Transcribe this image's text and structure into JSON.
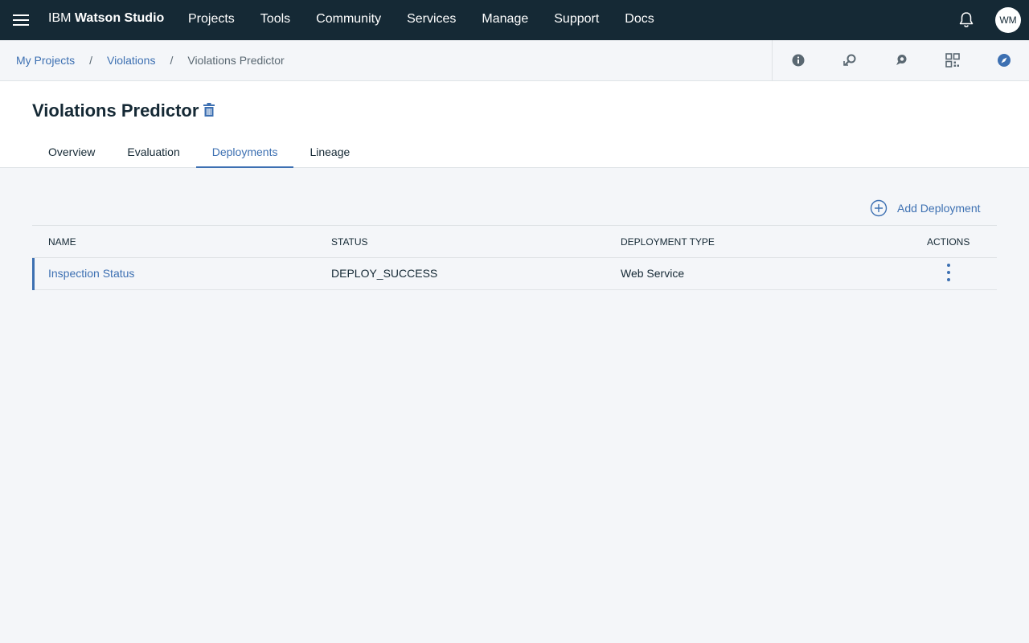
{
  "topbar": {
    "brand_prefix": "IBM",
    "brand_name": "Watson Studio",
    "nav": [
      "Projects",
      "Tools",
      "Community",
      "Services",
      "Manage",
      "Support",
      "Docs"
    ],
    "avatar_initials": "WM"
  },
  "breadcrumb": {
    "items": [
      "My Projects",
      "Violations"
    ],
    "separator": "/",
    "current": "Violations Predictor"
  },
  "toolbar_icons": [
    "info-icon",
    "find-data-icon",
    "comments-icon",
    "qr-grid-icon",
    "compass-icon"
  ],
  "header": {
    "title": "Violations Predictor",
    "tabs": [
      "Overview",
      "Evaluation",
      "Deployments",
      "Lineage"
    ],
    "active_tab": "Deployments"
  },
  "content": {
    "add_deployment_label": "Add Deployment",
    "table": {
      "columns": [
        "NAME",
        "STATUS",
        "DEPLOYMENT TYPE",
        "ACTIONS"
      ],
      "rows": [
        {
          "name": "Inspection Status",
          "status": "DEPLOY_SUCCESS",
          "type": "Web Service"
        }
      ]
    }
  },
  "colors": {
    "topbar_bg": "#152935",
    "accent": "#3d70b2",
    "page_bg": "#f4f6f9"
  }
}
